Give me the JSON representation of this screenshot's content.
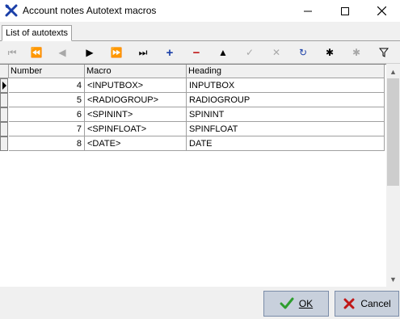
{
  "window": {
    "title": "Account notes Autotext macros",
    "icon": "tools-icon",
    "controls": [
      "minimize-icon",
      "maximize-icon",
      "close-icon"
    ]
  },
  "tabs": [
    {
      "label": "List of autotexts",
      "active": true
    }
  ],
  "toolbar": {
    "buttons": [
      {
        "name": "first-record",
        "glyph": "⏮",
        "enabled": false
      },
      {
        "name": "prior-page",
        "glyph": "⏪",
        "enabled": false
      },
      {
        "name": "prior-record",
        "glyph": "◀",
        "enabled": false
      },
      {
        "name": "next-record",
        "glyph": "▶",
        "enabled": true
      },
      {
        "name": "next-page",
        "glyph": "⏩",
        "enabled": true
      },
      {
        "name": "last-record",
        "glyph": "⏭",
        "enabled": true
      },
      {
        "name": "insert-record",
        "glyph": "+",
        "enabled": true
      },
      {
        "name": "delete-record",
        "glyph": "−",
        "enabled": true
      },
      {
        "name": "edit-record",
        "glyph": "▲",
        "enabled": true
      },
      {
        "name": "post-edit",
        "glyph": "✓",
        "enabled": false
      },
      {
        "name": "cancel-edit",
        "glyph": "✕",
        "enabled": false
      },
      {
        "name": "refresh",
        "glyph": "↻",
        "enabled": true
      },
      {
        "name": "bookmark",
        "glyph": "✱",
        "enabled": true
      },
      {
        "name": "goto-bookmark",
        "glyph": "✱",
        "enabled": false
      },
      {
        "name": "filter",
        "glyph": "⏷",
        "enabled": true
      }
    ]
  },
  "grid": {
    "columns": [
      "Number",
      "Macro",
      "Heading"
    ],
    "rows": [
      {
        "number": "4",
        "macro": "<INPUTBOX>",
        "heading": "INPUTBOX",
        "current": true
      },
      {
        "number": "5",
        "macro": "<RADIOGROUP>",
        "heading": "RADIOGROUP",
        "current": false
      },
      {
        "number": "6",
        "macro": "<SPININT>",
        "heading": "SPININT",
        "current": false
      },
      {
        "number": "7",
        "macro": "<SPINFLOAT>",
        "heading": "SPINFLOAT",
        "current": false
      },
      {
        "number": "8",
        "macro": "<DATE>",
        "heading": "DATE",
        "current": false
      }
    ]
  },
  "buttons": {
    "ok_label": "OK",
    "cancel_label": "Cancel"
  },
  "colors": {
    "button_bg": "#c8d0dc",
    "ok_check": "#2e9e2e",
    "cancel_x": "#c01818",
    "blue_glyph": "#1a3fa8",
    "red_glyph": "#c01818"
  }
}
